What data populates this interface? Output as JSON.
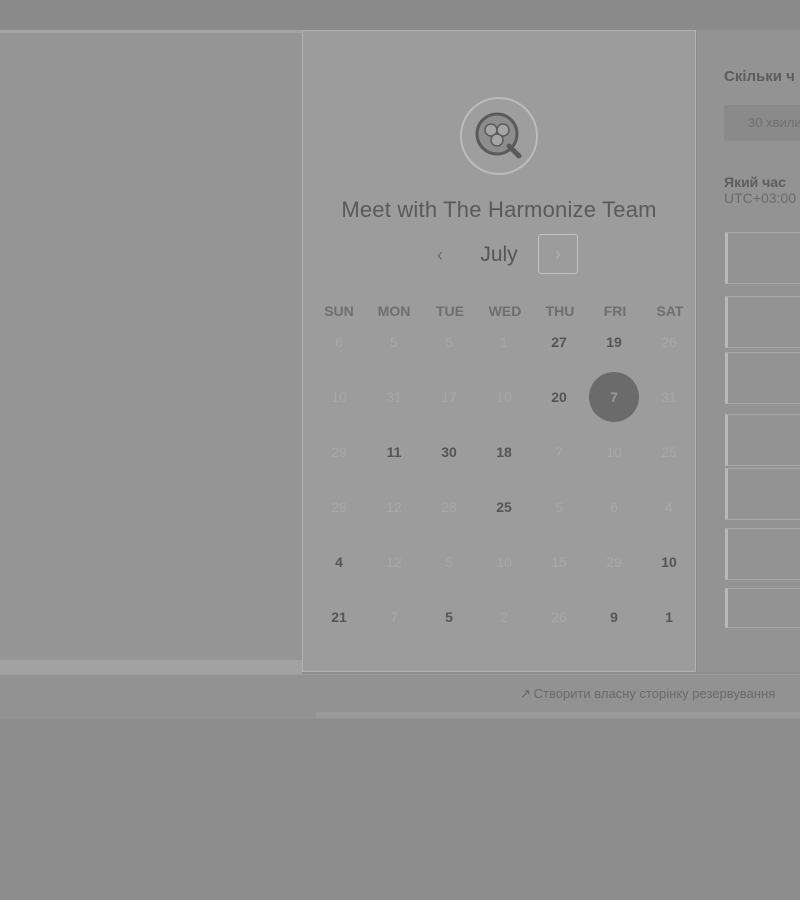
{
  "scheduler": {
    "heading": "Meet with The Harmonize Team",
    "month": "July",
    "prev_symbol": "‹",
    "next_symbol": "›",
    "weekdays": [
      "SUN",
      "MON",
      "TUE",
      "WED",
      "THU",
      "FRI",
      "SAT"
    ],
    "weeks": [
      [
        {
          "d": "6",
          "s": "disabled"
        },
        {
          "d": "5",
          "s": "disabled"
        },
        {
          "d": "5",
          "s": "disabled"
        },
        {
          "d": "1",
          "s": "disabled"
        },
        {
          "d": "27",
          "s": "available"
        },
        {
          "d": "19",
          "s": "available"
        },
        {
          "d": "26",
          "s": "disabled"
        }
      ],
      [
        {
          "d": "10",
          "s": "disabled"
        },
        {
          "d": "31",
          "s": "disabled"
        },
        {
          "d": "17",
          "s": "disabled"
        },
        {
          "d": "10",
          "s": "disabled"
        },
        {
          "d": "20",
          "s": "available"
        },
        {
          "d": "7",
          "s": "selected"
        },
        {
          "d": "31",
          "s": "disabled"
        }
      ],
      [
        {
          "d": "29",
          "s": "disabled"
        },
        {
          "d": "11",
          "s": "available"
        },
        {
          "d": "30",
          "s": "available"
        },
        {
          "d": "18",
          "s": "available"
        },
        {
          "d": "7",
          "s": "disabled"
        },
        {
          "d": "10",
          "s": "disabled"
        },
        {
          "d": "25",
          "s": "disabled"
        }
      ],
      [
        {
          "d": "29",
          "s": "disabled"
        },
        {
          "d": "12",
          "s": "disabled"
        },
        {
          "d": "28",
          "s": "disabled"
        },
        {
          "d": "25",
          "s": "available"
        },
        {
          "d": "5",
          "s": "disabled"
        },
        {
          "d": "6",
          "s": "disabled"
        },
        {
          "d": "4",
          "s": "disabled"
        }
      ],
      [
        {
          "d": "4",
          "s": "available"
        },
        {
          "d": "12",
          "s": "disabled"
        },
        {
          "d": "5",
          "s": "disabled"
        },
        {
          "d": "10",
          "s": "disabled"
        },
        {
          "d": "15",
          "s": "disabled"
        },
        {
          "d": "29",
          "s": "disabled"
        },
        {
          "d": "10",
          "s": "available"
        }
      ],
      [
        {
          "d": "21",
          "s": "available"
        },
        {
          "d": "7",
          "s": "disabled"
        },
        {
          "d": "5",
          "s": "available"
        },
        {
          "d": "2",
          "s": "disabled"
        },
        {
          "d": "26",
          "s": "disabled"
        },
        {
          "d": "9",
          "s": "available"
        },
        {
          "d": "1",
          "s": "available"
        }
      ]
    ]
  },
  "right_panel": {
    "duration_title": "Скільки ч",
    "duration_value": "30 хвили",
    "time_title": "Який час",
    "timezone": "UTC+03:00"
  },
  "footer": {
    "note": "Створити власну сторінку резервування"
  },
  "colors": {
    "selected_day": "#6b6b6b",
    "available_day": "#555555",
    "disabled_day": "#a8a8a8"
  }
}
